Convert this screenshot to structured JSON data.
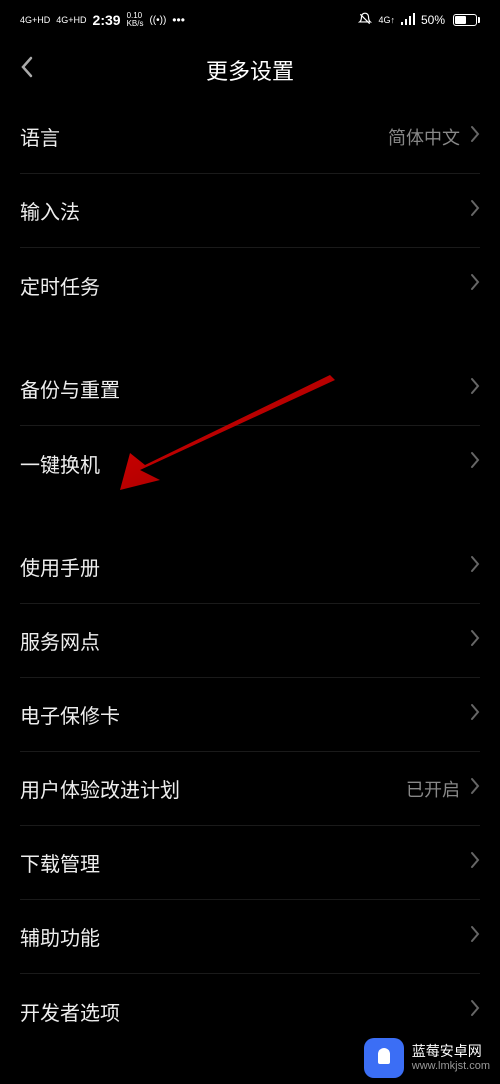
{
  "status_bar": {
    "net1": "4G+HD",
    "net2": "4G+HD",
    "time": "2:39",
    "speed_val": "0.10",
    "speed_unit": "KB/s",
    "wifi": "((•))",
    "more": "•••",
    "alarm": "🔕",
    "net_right": "4G↑",
    "battery_pct": "50%"
  },
  "header": {
    "title": "更多设置"
  },
  "groups": [
    {
      "items": [
        {
          "label": "语言",
          "value": "简体中文",
          "name": "language"
        },
        {
          "label": "输入法",
          "value": "",
          "name": "input-method"
        },
        {
          "label": "定时任务",
          "value": "",
          "name": "scheduled-tasks"
        }
      ]
    },
    {
      "items": [
        {
          "label": "备份与重置",
          "value": "",
          "name": "backup-reset"
        },
        {
          "label": "一键换机",
          "value": "",
          "name": "phone-clone"
        }
      ]
    },
    {
      "items": [
        {
          "label": "使用手册",
          "value": "",
          "name": "user-manual"
        },
        {
          "label": "服务网点",
          "value": "",
          "name": "service-center"
        },
        {
          "label": "电子保修卡",
          "value": "",
          "name": "warranty-card"
        },
        {
          "label": "用户体验改进计划",
          "value": "已开启",
          "name": "ux-improvement"
        },
        {
          "label": "下载管理",
          "value": "",
          "name": "download-manager"
        },
        {
          "label": "辅助功能",
          "value": "",
          "name": "accessibility"
        },
        {
          "label": "开发者选项",
          "value": "",
          "name": "developer-options"
        }
      ]
    }
  ],
  "watermark": {
    "title": "蓝莓安卓网",
    "url": "www.lmkjst.com"
  }
}
